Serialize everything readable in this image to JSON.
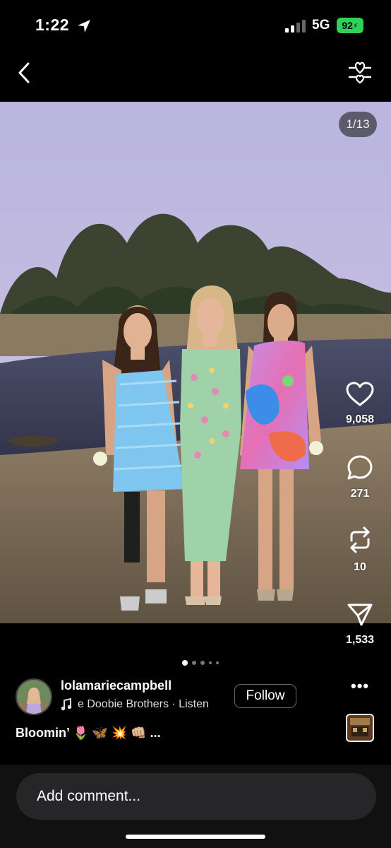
{
  "status_bar": {
    "time": "1:22",
    "network": "5G",
    "battery": "92"
  },
  "photo": {
    "counter": "1/13"
  },
  "actions": {
    "likes": "9,058",
    "comments": "271",
    "reposts": "10",
    "shares": "1,533"
  },
  "post": {
    "username": "lolamariecampbell",
    "music": "e Doobie Brothers · Listen",
    "follow_label": "Follow",
    "caption": "Bloomin’ 🌷 🦋 💥 👊🏼 ..."
  },
  "comment": {
    "placeholder": "Add comment..."
  },
  "colors": {
    "battery": "#30d158",
    "background": "#000000",
    "accent": "#ffffff"
  },
  "icons": [
    "location-arrow-icon",
    "signal-icon",
    "back-chevron-icon",
    "filter-icon",
    "heart-icon",
    "comment-icon",
    "repost-icon",
    "share-icon",
    "music-note-icon",
    "more-icon"
  ]
}
